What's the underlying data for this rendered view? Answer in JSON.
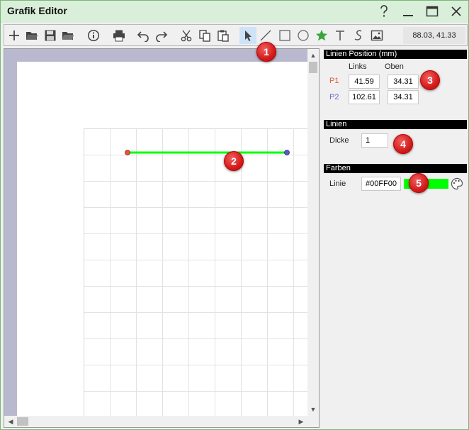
{
  "window": {
    "title": "Grafik Editor"
  },
  "toolbar": {
    "coords": "88.03, 41.33"
  },
  "panel": {
    "position_header": "Linien Position (mm)",
    "col_left": "Links",
    "col_top": "Oben",
    "p1_label": "P1",
    "p1_left": "41.59",
    "p1_top": "34.31",
    "p2_label": "P2",
    "p2_left": "102.61",
    "p2_top": "34.31",
    "lines_header": "Linien",
    "thickness_label": "Dicke",
    "thickness_value": "1",
    "colors_header": "Farben",
    "line_color_label": "Linie",
    "line_color_value": "#00FF00"
  },
  "colors": {
    "line": "#00FF00",
    "titlebar": "#daefd9",
    "p1_point": "#e8553a",
    "p2_point": "#5a5ac8",
    "marker": "#d41b1b"
  },
  "markers": [
    "1",
    "2",
    "3",
    "4",
    "5"
  ],
  "icons": [
    "new-icon",
    "open-icon",
    "save-icon",
    "open-folder-icon",
    "info-icon",
    "print-icon",
    "undo-icon",
    "redo-icon",
    "cut-icon",
    "copy-icon",
    "paste-icon",
    "select-arrow-icon",
    "line-icon",
    "rectangle-icon",
    "circle-icon",
    "star-icon",
    "text-icon",
    "script-text-icon",
    "image-icon",
    "palette-icon"
  ]
}
